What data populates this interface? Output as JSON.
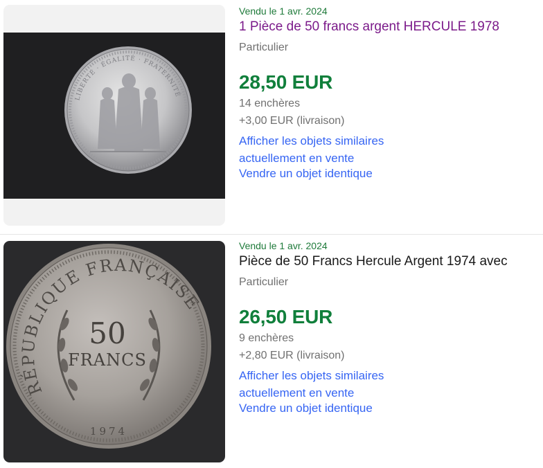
{
  "listings": [
    {
      "sold_date": "Vendu le 1 avr. 2024",
      "title": "1 Pièce de 50 francs argent HERCULE 1978",
      "seller_type": "Particulier",
      "price": "28,50 EUR",
      "bids": "14 enchères",
      "shipping": "+3,00 EUR (livraison)",
      "similar_link": "Afficher les objets similaires actuellement en vente",
      "sell_link": "Vendre un objet identique",
      "coin_inscription": "LIBERTÉ · ÉGALITÉ · FRATERNITÉ"
    },
    {
      "sold_date": "Vendu le 1 avr. 2024",
      "title": "Pièce de 50 Francs Hercule Argent 1974 avec",
      "seller_type": "Particulier",
      "price": "26,50 EUR",
      "bids": "9 enchères",
      "shipping": "+2,80 EUR (livraison)",
      "similar_link": "Afficher les objets similaires actuellement en vente",
      "sell_link": "Vendre un objet identique",
      "coin_value": "50",
      "coin_unit": "FRANCS",
      "coin_legend": "RÉPUBLIQUE FRANÇAISE",
      "coin_year": "1974"
    }
  ],
  "colors": {
    "sold_green": "#1e7a3a",
    "price_green": "#107f3b",
    "visited_title": "#7b1a8a",
    "link_blue": "#3665f3",
    "muted_gray": "#707070"
  }
}
